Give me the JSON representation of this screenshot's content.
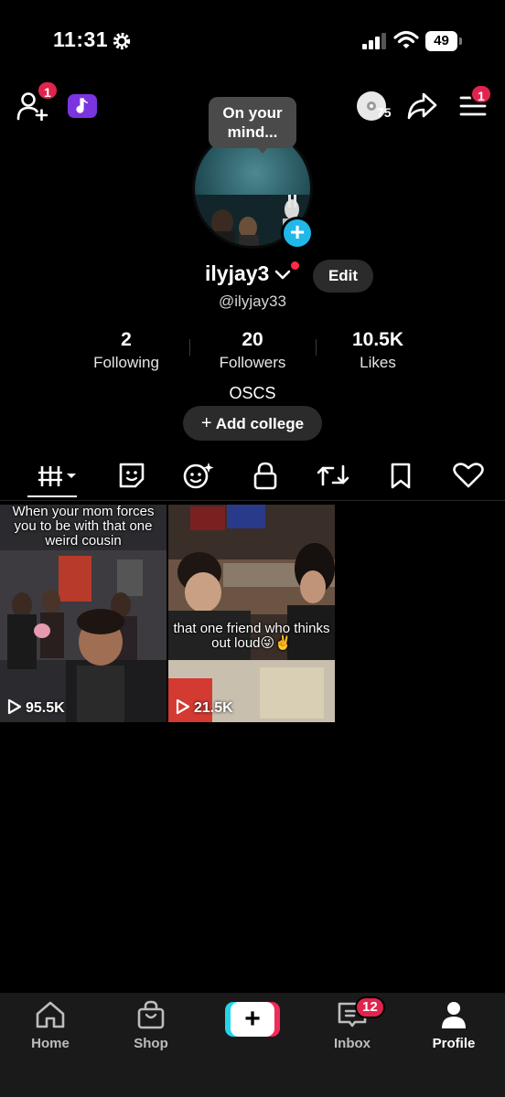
{
  "status_bar": {
    "time": "11:31",
    "battery": "49"
  },
  "top_bar": {
    "add_friends_badge": "1",
    "coins_count": "75",
    "menu_badge": "1"
  },
  "profile": {
    "mind_prompt_line1": "On your",
    "mind_prompt_line2": "mind...",
    "display_name": "ilyjay3",
    "edit_label": "Edit",
    "handle": "@ilyjay33",
    "stats": [
      {
        "value": "2",
        "label": "Following"
      },
      {
        "value": "20",
        "label": "Followers"
      },
      {
        "value": "10.5K",
        "label": "Likes"
      }
    ],
    "bio": "OSCS",
    "add_college_label": "Add college"
  },
  "videos": [
    {
      "caption": "When your mom forces you to be with that one weird cousin",
      "plays": "95.5K"
    },
    {
      "caption": "that one friend who thinks out loud😜✌️",
      "plays": "21.5K"
    }
  ],
  "bottom_nav": {
    "home": "Home",
    "shop": "Shop",
    "inbox": "Inbox",
    "inbox_badge": "12",
    "profile": "Profile"
  },
  "colors": {
    "accent_red": "#e0244e",
    "accent_cyan": "#20b8e8",
    "music_purple": "#7a34e0"
  }
}
